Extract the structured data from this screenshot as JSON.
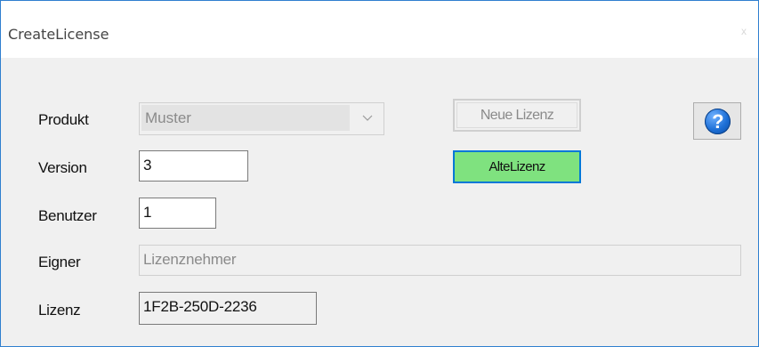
{
  "window": {
    "title": "CreateLicense",
    "close_label": "x"
  },
  "form": {
    "produkt_label": "Produkt",
    "produkt_value": "Muster",
    "version_label": "Version",
    "version_value": "3",
    "benutzer_label": "Benutzer",
    "benutzer_value": "1",
    "eigner_label": "Eigner",
    "eigner_value": "Lizenznehmer",
    "lizenz_label": "Lizenz",
    "lizenz_value": "1F2B-250D-2236"
  },
  "buttons": {
    "neue_lizenz_label": "Neue Lizenz",
    "alte_lizenz_label": "AlteLizenz",
    "help_icon": "help-question-icon",
    "help_glyph": "?"
  },
  "colors": {
    "accent_border": "#0078d7",
    "alte_lizenz_bg": "#7fe27f",
    "window_border": "#2f7fcf",
    "dialog_bg": "#f0f0f0"
  }
}
